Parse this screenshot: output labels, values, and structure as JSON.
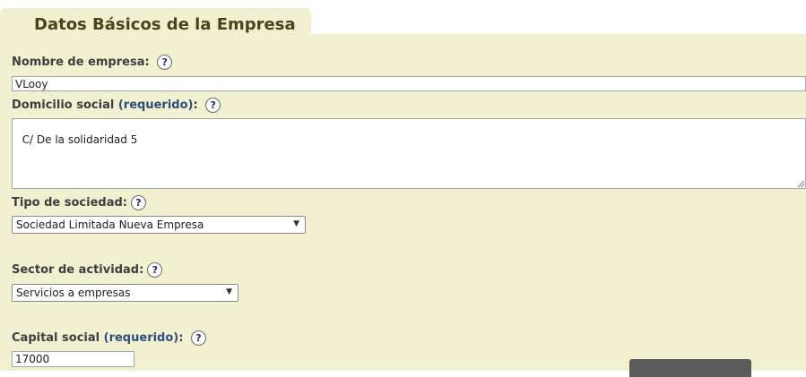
{
  "tab": {
    "title": "Datos Básicos de la Empresa"
  },
  "fields": {
    "company_name": {
      "label": "Nombre de empresa:",
      "value": "VLooy"
    },
    "address": {
      "label": "Domicilio social",
      "required": "(requerido)",
      "colon": ":",
      "value": "C/ De la solidaridad 5"
    },
    "company_type": {
      "label": "Tipo de sociedad:",
      "value": "Sociedad Limitada Nueva Empresa"
    },
    "sector": {
      "label": "Sector de actividad:",
      "value": "Servicios a empresas"
    },
    "capital": {
      "label": "Capital social",
      "required": "(requerido)",
      "colon": ":",
      "value": "17000"
    }
  },
  "help_glyph": "?",
  "select_arrow": "▼",
  "colors": {
    "panel": "#f1f1d2",
    "title": "#47451b",
    "required": "#2f4e7a"
  }
}
